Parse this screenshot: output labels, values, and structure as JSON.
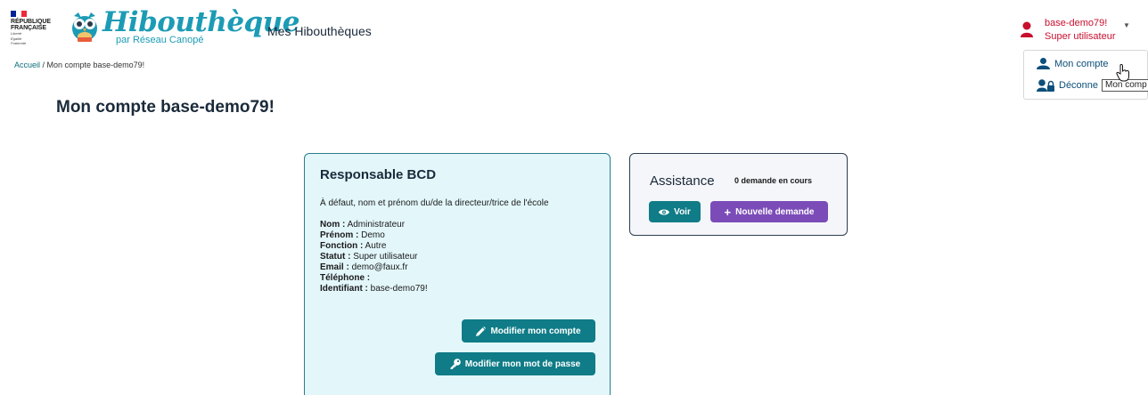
{
  "header": {
    "rf_logo_lines": [
      "RÉPUBLIQUE",
      "FRANÇAISE"
    ],
    "rf_logo_motto": [
      "Liberté",
      "Égalité",
      "Fraternité"
    ],
    "brand_title": "Hibouthèque",
    "brand_subtitle": "par Réseau Canopé",
    "nav_link": "Mes Hibouthèques",
    "user_name": "base-demo79!",
    "user_role": "Super utilisateur"
  },
  "breadcrumb": {
    "home": "Accueil",
    "separator": " / ",
    "current": "Mon compte base-demo79!"
  },
  "user_menu": {
    "items": [
      {
        "label": "Mon compte",
        "icon": "user-icon"
      },
      {
        "label": "Déconne",
        "icon": "user-lock-icon"
      }
    ],
    "tooltip": "Mon comp"
  },
  "page": {
    "title": "Mon compte base-demo79!"
  },
  "responsable": {
    "title": "Responsable BCD",
    "description": "À défaut, nom et prénom du/de la directeur/trice de l'école",
    "fields": [
      {
        "label": "Nom :",
        "value": " Administrateur"
      },
      {
        "label": "Prénom :",
        "value": " Demo"
      },
      {
        "label": "Fonction :",
        "value": " Autre"
      },
      {
        "label": "Statut :",
        "value": " Super utilisateur"
      },
      {
        "label": "Email :",
        "value": " demo@faux.fr"
      },
      {
        "label": "Téléphone :",
        "value": ""
      },
      {
        "label": "Identifiant :",
        "value": " base-demo79!"
      }
    ],
    "edit_account_button": "Modifier mon compte",
    "edit_password_button": "Modifier mon mot de passe"
  },
  "assistance": {
    "title": "Assistance",
    "count_text": "0 demande en cours",
    "view_button": "Voir",
    "new_request_button": "Nouvelle demande"
  },
  "colors": {
    "brand": "#1c9bb5",
    "accent_teal": "#0f7c87",
    "accent_violet": "#7b4cb8",
    "user_red": "#c8102e",
    "link_blue": "#0b4f7a",
    "card_bg": "#e3f7fb"
  }
}
